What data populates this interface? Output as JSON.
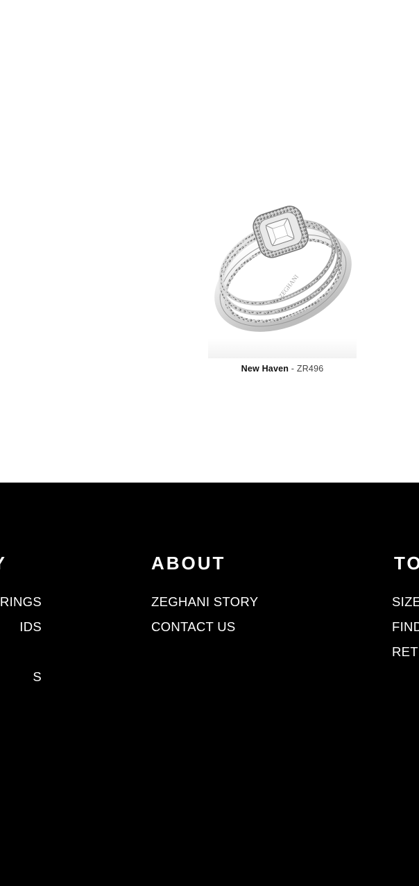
{
  "product": {
    "name": "New Haven",
    "separator": "-",
    "sku": "ZR496",
    "image_icon": "diamond-ring-set-image",
    "engraving": "ZEGHANI"
  },
  "footer": {
    "left_column": {
      "heading": "Y",
      "links": [
        "RINGS",
        "IDS",
        "",
        "S"
      ]
    },
    "about_column": {
      "heading": "ABOUT",
      "links": [
        "ZEGHANI STORY",
        "CONTACT US"
      ]
    },
    "right_column": {
      "heading": "TO",
      "links": [
        "SIZE",
        "FIND",
        "RETU"
      ]
    }
  },
  "colors": {
    "footer_background": "#000000",
    "footer_text": "#ffffff",
    "page_background": "#ffffff"
  }
}
